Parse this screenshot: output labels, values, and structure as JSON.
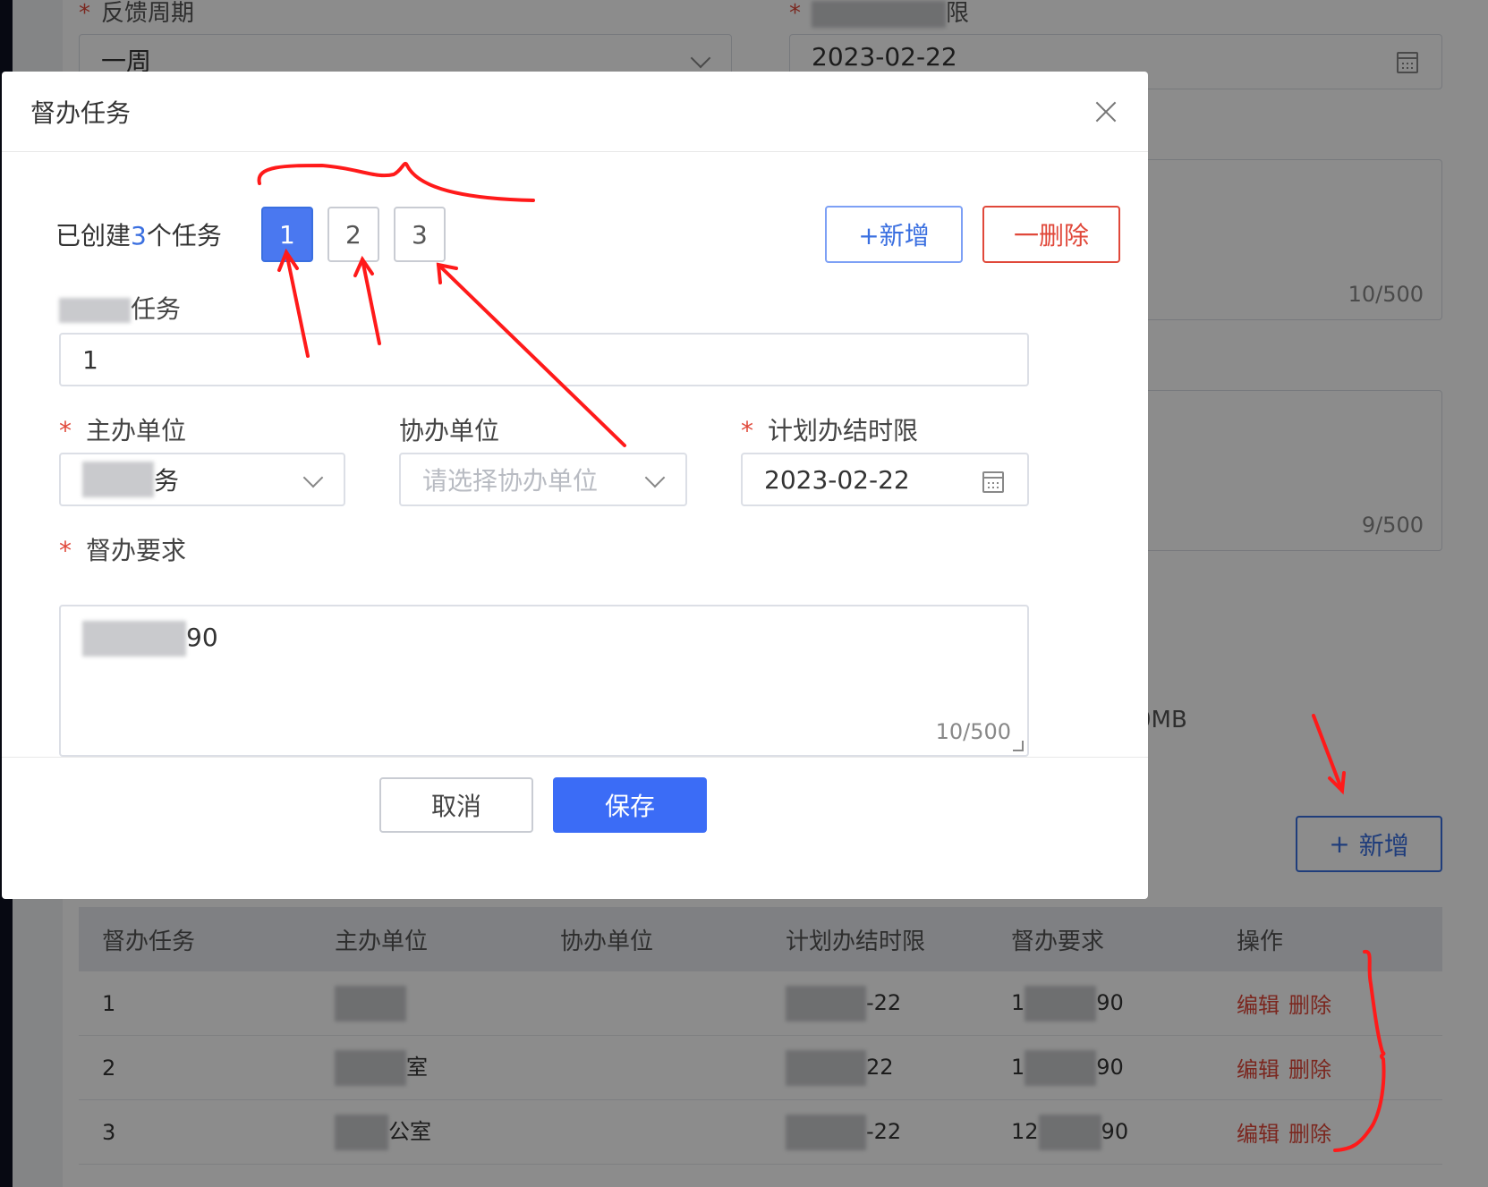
{
  "background": {
    "feedback_cycle_label": "反馈周期",
    "feedback_cycle_value": "一周",
    "deadline_label_fragment": "限",
    "deadline_value": "2023-02-22",
    "count_1": "10/500",
    "count_2": "9/500",
    "upload_hint_fragment": "0MB",
    "add_button": "新增",
    "table": {
      "headers": [
        "督办任务",
        "主办单位",
        "协办单位",
        "计划办结时限",
        "督办要求",
        "操作"
      ],
      "rows": [
        {
          "task": "1",
          "host_fragment": "",
          "assist": "",
          "deadline_fragment": "-22",
          "req_prefix": "1",
          "req_suffix": "90"
        },
        {
          "task": "2",
          "host_fragment": "室",
          "assist": "",
          "deadline_fragment": "22",
          "req_prefix": "1",
          "req_suffix": "90"
        },
        {
          "task": "3",
          "host_fragment": "公室",
          "assist": "",
          "deadline_fragment": "-22",
          "req_prefix": "12",
          "req_suffix": "90"
        }
      ],
      "edit_label": "编辑",
      "delete_label": "删除"
    }
  },
  "modal": {
    "title": "督办任务",
    "created_prefix": "已创建",
    "created_count": "3",
    "created_suffix": "个任务",
    "tabs": [
      "1",
      "2",
      "3"
    ],
    "active_tab": "1",
    "add_label": "+新增",
    "delete_label": "一删除",
    "task_label_fragment": "任务",
    "task_value": "1",
    "host_unit_label": "主办单位",
    "host_unit_value_fragment": "务",
    "assist_unit_label": "协办单位",
    "assist_unit_placeholder": "请选择协办单位",
    "deadline_label": "计划办结时限",
    "deadline_value": "2023-02-22",
    "requirement_label": "督办要求",
    "requirement_value_fragment": "90",
    "requirement_count": "10/500",
    "cancel_label": "取消",
    "save_label": "保存"
  },
  "colors": {
    "primary": "#3b6cf6",
    "danger": "#e0483a",
    "annotation": "#ff1a1a"
  }
}
